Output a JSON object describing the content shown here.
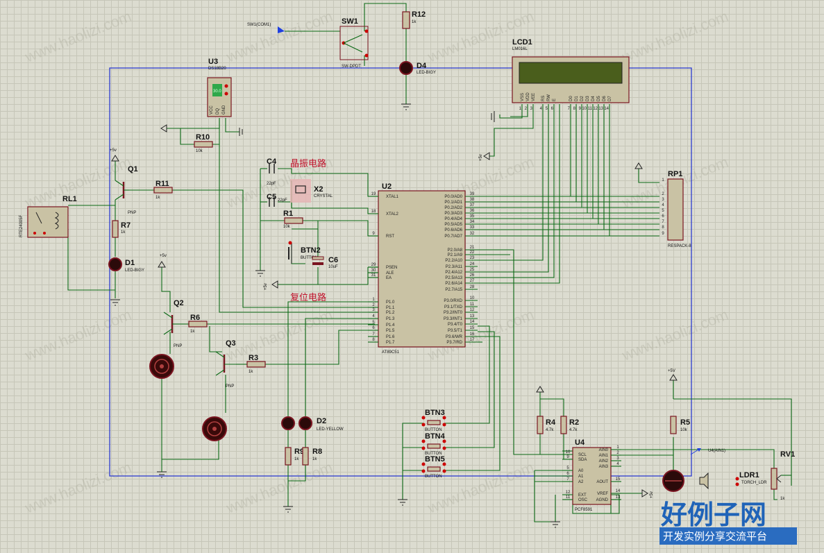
{
  "watermark": "www.haolizi.com",
  "brand": {
    "main": "好例子网",
    "sub": "开发实例分享交流平台"
  },
  "labels": {
    "crystal_circuit": "晶振电路",
    "reset_circuit": "复位电路"
  },
  "components": {
    "sw1": {
      "ref": "SW1",
      "value": "SW-DPDT",
      "terminal": "SW1(COM1)"
    },
    "r12": {
      "ref": "R12",
      "value": "1k"
    },
    "d4": {
      "ref": "D4",
      "value": "LED-BIGY"
    },
    "lcd1": {
      "ref": "LCD1",
      "value": "LM016L",
      "pins": [
        "VSS",
        "VDD",
        "VEE",
        "RS",
        "RW",
        "E",
        "D0",
        "D1",
        "D2",
        "D3",
        "D4",
        "D5",
        "D6",
        "D7"
      ],
      "pin_numbers": [
        "1",
        "2",
        "3",
        "4",
        "5",
        "6",
        "7",
        "8",
        "9",
        "10",
        "11",
        "12",
        "13",
        "14"
      ]
    },
    "u3": {
      "ref": "U3",
      "value": "DS18B20",
      "display": "30.0",
      "pins": [
        "VCC",
        "DQ",
        "GND"
      ]
    },
    "r10": {
      "ref": "R10",
      "value": "10k"
    },
    "q1": {
      "ref": "Q1",
      "value": "PNP"
    },
    "q2": {
      "ref": "Q2",
      "value": "PNP"
    },
    "q3": {
      "ref": "Q3",
      "value": "PNP"
    },
    "r11": {
      "ref": "R11",
      "value": "1k"
    },
    "r7": {
      "ref": "R7",
      "value": "1k"
    },
    "r6": {
      "ref": "R6",
      "value": "1k"
    },
    "r3": {
      "ref": "R3",
      "value": "1k"
    },
    "rl1": {
      "ref": "RL1",
      "value": "RTE24005F"
    },
    "d1": {
      "ref": "D1",
      "value": "LED-BIGY"
    },
    "d2": {
      "ref": "D2",
      "value": "LED-YELLOW"
    },
    "r9": {
      "ref": "R9",
      "value": "1k"
    },
    "r8": {
      "ref": "R8",
      "value": "1k"
    },
    "c4": {
      "ref": "C4",
      "value": "22pF"
    },
    "c5": {
      "ref": "C5",
      "value": "22pF"
    },
    "x2": {
      "ref": "X2",
      "value": "CRYSTAL"
    },
    "r1": {
      "ref": "R1",
      "value": "10k"
    },
    "btn2": {
      "ref": "BTN2",
      "value": "BUTTON"
    },
    "c6": {
      "ref": "C6",
      "value": "10uF"
    },
    "u2": {
      "ref": "U2",
      "value": "AT89C51",
      "left_pins": [
        [
          "19",
          "XTAL1"
        ],
        [
          "18",
          "XTAL2"
        ],
        [
          "9",
          "RST"
        ],
        [
          "29",
          "PSEN"
        ],
        [
          "30",
          "ALE"
        ],
        [
          "31",
          "EA"
        ],
        [
          "1",
          "P1.0"
        ],
        [
          "2",
          "P1.1"
        ],
        [
          "3",
          "P1.2"
        ],
        [
          "4",
          "P1.3"
        ],
        [
          "5",
          "P1.4"
        ],
        [
          "6",
          "P1.5"
        ],
        [
          "7",
          "P1.6"
        ],
        [
          "8",
          "P1.7"
        ]
      ],
      "right_pins": [
        [
          "39",
          "P0.0/AD0"
        ],
        [
          "38",
          "P0.1/AD1"
        ],
        [
          "37",
          "P0.2/AD2"
        ],
        [
          "36",
          "P0.3/AD3"
        ],
        [
          "35",
          "P0.4/AD4"
        ],
        [
          "34",
          "P0.5/AD5"
        ],
        [
          "33",
          "P0.6/AD6"
        ],
        [
          "32",
          "P0.7/AD7"
        ],
        [
          "21",
          "P2.0/A8"
        ],
        [
          "22",
          "P2.1/A9"
        ],
        [
          "23",
          "P2.2/A10"
        ],
        [
          "24",
          "P2.3/A11"
        ],
        [
          "25",
          "P2.4/A12"
        ],
        [
          "26",
          "P2.5/A13"
        ],
        [
          "27",
          "P2.6/A14"
        ],
        [
          "28",
          "P2.7/A15"
        ],
        [
          "10",
          "P3.0/RXD"
        ],
        [
          "11",
          "P3.1/TXD"
        ],
        [
          "12",
          "P3.2/INT0"
        ],
        [
          "13",
          "P3.3/INT1"
        ],
        [
          "14",
          "P3.4/T0"
        ],
        [
          "15",
          "P3.5/T1"
        ],
        [
          "16",
          "P3.6/WR"
        ],
        [
          "17",
          "P3.7/RD"
        ]
      ]
    },
    "rp1": {
      "ref": "RP1",
      "value": "RESPACK-8",
      "pins": [
        "1",
        "2",
        "3",
        "4",
        "5",
        "6",
        "7",
        "8",
        "9"
      ]
    },
    "btn3": {
      "ref": "BTN3",
      "value": "BUTTON"
    },
    "btn4": {
      "ref": "BTN4",
      "value": "BUTTON"
    },
    "btn5": {
      "ref": "BTN5",
      "value": "BUTTON"
    },
    "r4": {
      "ref": "R4",
      "value": "4.7k"
    },
    "r2": {
      "ref": "R2",
      "value": "4.7k"
    },
    "u4": {
      "ref": "U4",
      "value": "PCF8591",
      "left_pins": [
        [
          "10",
          "SCL"
        ],
        [
          "9",
          "SDA"
        ],
        [
          "5",
          "A0"
        ],
        [
          "6",
          "A1"
        ],
        [
          "7",
          "A2"
        ],
        [
          "12",
          "EXT"
        ],
        [
          "11",
          "OSC"
        ]
      ],
      "right_pins": [
        [
          "1",
          "AIN0"
        ],
        [
          "2",
          "AIN1"
        ],
        [
          "3",
          "AIN2"
        ],
        [
          "4",
          "AIN3"
        ],
        [
          "15",
          "AOUT"
        ],
        [
          "14",
          "VREF"
        ],
        [
          "13",
          "AGND"
        ]
      ],
      "terminal": "U4(AIN1)"
    },
    "r5": {
      "ref": "R5",
      "value": "10k"
    },
    "rv1": {
      "ref": "RV1",
      "value": "1k"
    },
    "ldr1": {
      "ref": "LDR1",
      "value": "TORCH_LDR"
    }
  },
  "power": {
    "vcc": "+5V",
    "vcc_lower": "+5v"
  }
}
